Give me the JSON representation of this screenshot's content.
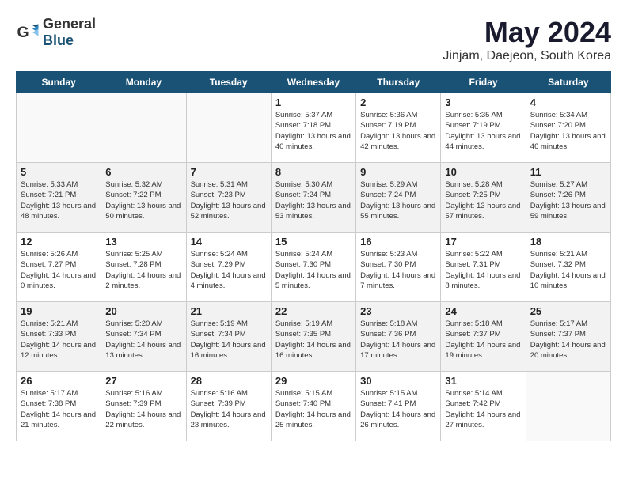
{
  "header": {
    "logo_general": "General",
    "logo_blue": "Blue",
    "month_title": "May 2024",
    "location": "Jinjam, Daejeon, South Korea"
  },
  "weekdays": [
    "Sunday",
    "Monday",
    "Tuesday",
    "Wednesday",
    "Thursday",
    "Friday",
    "Saturday"
  ],
  "weeks": [
    [
      {
        "day": "",
        "empty": true
      },
      {
        "day": "",
        "empty": true
      },
      {
        "day": "",
        "empty": true
      },
      {
        "day": "1",
        "sunrise": "5:37 AM",
        "sunset": "7:18 PM",
        "daylight": "13 hours and 40 minutes."
      },
      {
        "day": "2",
        "sunrise": "5:36 AM",
        "sunset": "7:19 PM",
        "daylight": "13 hours and 42 minutes."
      },
      {
        "day": "3",
        "sunrise": "5:35 AM",
        "sunset": "7:19 PM",
        "daylight": "13 hours and 44 minutes."
      },
      {
        "day": "4",
        "sunrise": "5:34 AM",
        "sunset": "7:20 PM",
        "daylight": "13 hours and 46 minutes."
      }
    ],
    [
      {
        "day": "5",
        "sunrise": "5:33 AM",
        "sunset": "7:21 PM",
        "daylight": "13 hours and 48 minutes."
      },
      {
        "day": "6",
        "sunrise": "5:32 AM",
        "sunset": "7:22 PM",
        "daylight": "13 hours and 50 minutes."
      },
      {
        "day": "7",
        "sunrise": "5:31 AM",
        "sunset": "7:23 PM",
        "daylight": "13 hours and 52 minutes."
      },
      {
        "day": "8",
        "sunrise": "5:30 AM",
        "sunset": "7:24 PM",
        "daylight": "13 hours and 53 minutes."
      },
      {
        "day": "9",
        "sunrise": "5:29 AM",
        "sunset": "7:24 PM",
        "daylight": "13 hours and 55 minutes."
      },
      {
        "day": "10",
        "sunrise": "5:28 AM",
        "sunset": "7:25 PM",
        "daylight": "13 hours and 57 minutes."
      },
      {
        "day": "11",
        "sunrise": "5:27 AM",
        "sunset": "7:26 PM",
        "daylight": "13 hours and 59 minutes."
      }
    ],
    [
      {
        "day": "12",
        "sunrise": "5:26 AM",
        "sunset": "7:27 PM",
        "daylight": "14 hours and 0 minutes."
      },
      {
        "day": "13",
        "sunrise": "5:25 AM",
        "sunset": "7:28 PM",
        "daylight": "14 hours and 2 minutes."
      },
      {
        "day": "14",
        "sunrise": "5:24 AM",
        "sunset": "7:29 PM",
        "daylight": "14 hours and 4 minutes."
      },
      {
        "day": "15",
        "sunrise": "5:24 AM",
        "sunset": "7:30 PM",
        "daylight": "14 hours and 5 minutes."
      },
      {
        "day": "16",
        "sunrise": "5:23 AM",
        "sunset": "7:30 PM",
        "daylight": "14 hours and 7 minutes."
      },
      {
        "day": "17",
        "sunrise": "5:22 AM",
        "sunset": "7:31 PM",
        "daylight": "14 hours and 8 minutes."
      },
      {
        "day": "18",
        "sunrise": "5:21 AM",
        "sunset": "7:32 PM",
        "daylight": "14 hours and 10 minutes."
      }
    ],
    [
      {
        "day": "19",
        "sunrise": "5:21 AM",
        "sunset": "7:33 PM",
        "daylight": "14 hours and 12 minutes."
      },
      {
        "day": "20",
        "sunrise": "5:20 AM",
        "sunset": "7:34 PM",
        "daylight": "14 hours and 13 minutes."
      },
      {
        "day": "21",
        "sunrise": "5:19 AM",
        "sunset": "7:34 PM",
        "daylight": "14 hours and 16 minutes."
      },
      {
        "day": "22",
        "sunrise": "5:19 AM",
        "sunset": "7:35 PM",
        "daylight": "14 hours and 16 minutes."
      },
      {
        "day": "23",
        "sunrise": "5:18 AM",
        "sunset": "7:36 PM",
        "daylight": "14 hours and 17 minutes."
      },
      {
        "day": "24",
        "sunrise": "5:18 AM",
        "sunset": "7:37 PM",
        "daylight": "14 hours and 19 minutes."
      },
      {
        "day": "25",
        "sunrise": "5:17 AM",
        "sunset": "7:37 PM",
        "daylight": "14 hours and 20 minutes."
      }
    ],
    [
      {
        "day": "26",
        "sunrise": "5:17 AM",
        "sunset": "7:38 PM",
        "daylight": "14 hours and 21 minutes."
      },
      {
        "day": "27",
        "sunrise": "5:16 AM",
        "sunset": "7:39 PM",
        "daylight": "14 hours and 22 minutes."
      },
      {
        "day": "28",
        "sunrise": "5:16 AM",
        "sunset": "7:39 PM",
        "daylight": "14 hours and 23 minutes."
      },
      {
        "day": "29",
        "sunrise": "5:15 AM",
        "sunset": "7:40 PM",
        "daylight": "14 hours and 25 minutes."
      },
      {
        "day": "30",
        "sunrise": "5:15 AM",
        "sunset": "7:41 PM",
        "daylight": "14 hours and 26 minutes."
      },
      {
        "day": "31",
        "sunrise": "5:14 AM",
        "sunset": "7:42 PM",
        "daylight": "14 hours and 27 minutes."
      },
      {
        "day": "",
        "empty": true
      }
    ]
  ]
}
